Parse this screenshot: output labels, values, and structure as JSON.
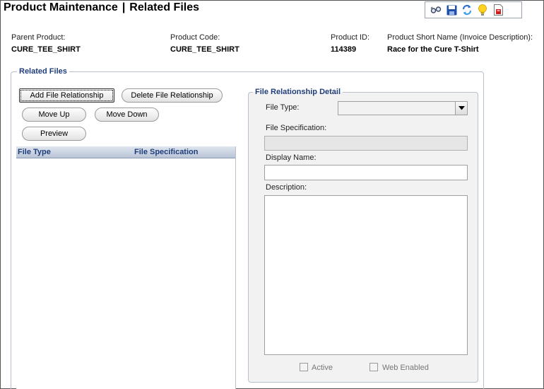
{
  "window": {
    "title_left": "Product Maintenance",
    "title_sep": "|",
    "title_right": "Related Files"
  },
  "toolbar": {
    "icons": [
      "glasses-icon",
      "save-icon",
      "refresh-icon",
      "lightbulb-icon",
      "pdf-report-icon"
    ]
  },
  "header": {
    "parent_product_label": "Parent Product:",
    "parent_product_value": "CURE_TEE_SHIRT",
    "product_code_label": "Product Code:",
    "product_code_value": "CURE_TEE_SHIRT",
    "product_id_label": "Product ID:",
    "product_id_value": "114389",
    "short_name_label": "Product Short Name (Invoice Description):",
    "short_name_value": "Race for the Cure T-Shirt"
  },
  "related_files": {
    "legend": "Related Files",
    "buttons": {
      "add": "Add File Relationship",
      "delete": "Delete File Relationship",
      "move_up": "Move Up",
      "move_down": "Move Down",
      "preview": "Preview"
    },
    "grid": {
      "columns": [
        "File Type",
        "File Specification"
      ],
      "rows": []
    }
  },
  "detail": {
    "legend": "File Relationship Detail",
    "file_type_label": "File Type:",
    "file_type_value": "",
    "file_spec_label": "File Specification:",
    "file_spec_value": "",
    "display_name_label": "Display Name:",
    "display_name_value": "",
    "description_label": "Description:",
    "description_value": "",
    "active_label": "Active",
    "web_enabled_label": "Web Enabled"
  },
  "colors": {
    "legend_text": "#1f3d7a",
    "grid_header": "#b9c4d6",
    "detail_bg": "#f2f2f2"
  }
}
